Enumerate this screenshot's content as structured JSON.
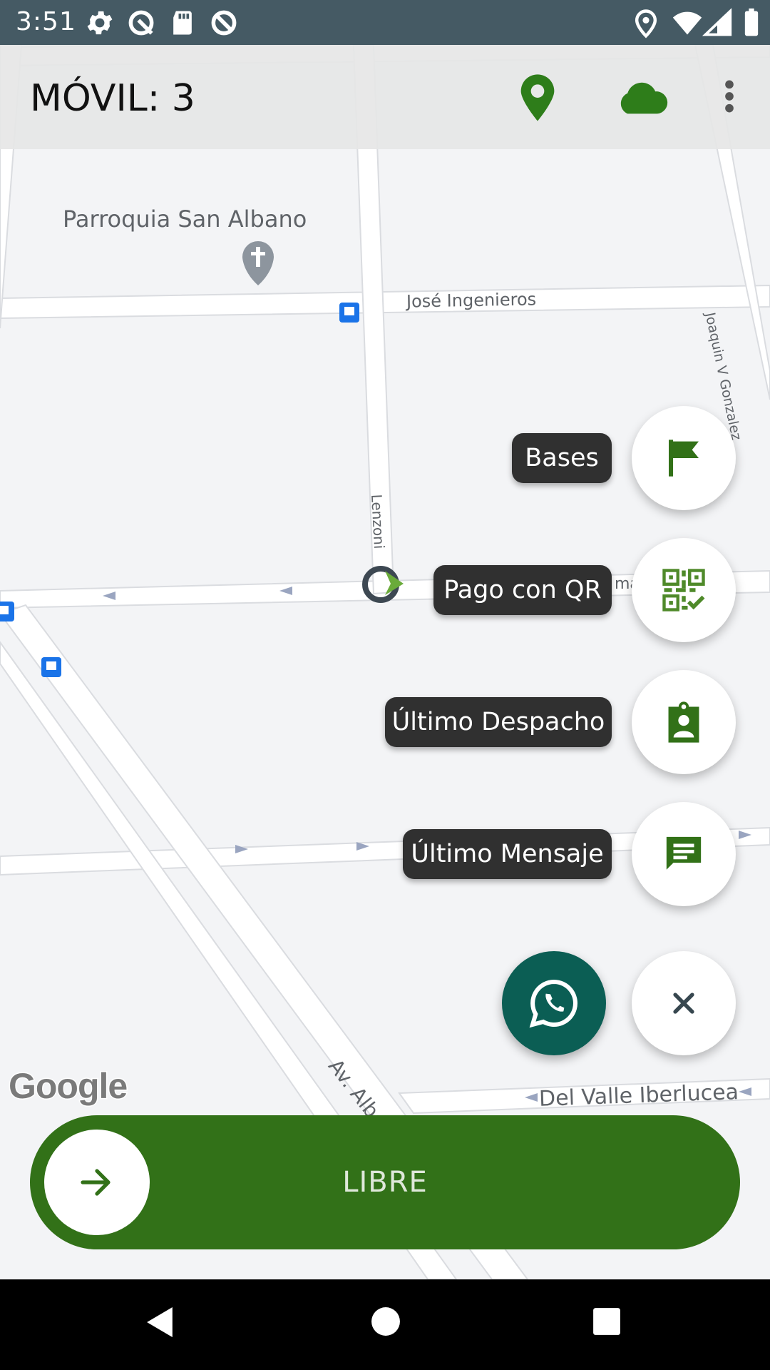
{
  "status_bar": {
    "time": "3:51"
  },
  "header": {
    "title": "MÓVIL: 3"
  },
  "map": {
    "poi_name": "Parroquia San Albano",
    "streets": {
      "jose_ingenieros": "José Ingenieros",
      "joaquin_gonzalez": "Joaquin V Gonzalez",
      "lenzoni": "Lenzoni",
      "partial_street": "ma",
      "av_alberdi": "Av. Alberdi",
      "del_valle": "Del Valle Iberlucea"
    },
    "attribution": "Google"
  },
  "fab_menu": {
    "items": [
      {
        "label": "Bases",
        "icon": "flag-icon"
      },
      {
        "label": "Pago con QR",
        "icon": "qr-code-icon"
      },
      {
        "label": "Último Despacho",
        "icon": "assignment-ind-icon"
      },
      {
        "label": "Último Mensaje",
        "icon": "message-icon"
      }
    ],
    "whatsapp_icon": "whatsapp-icon",
    "close_icon": "close-icon"
  },
  "slider": {
    "label": "LIBRE"
  },
  "colors": {
    "brand_green": "#327118",
    "icon_green": "#2e7d1a",
    "whatsapp": "#0b5e54",
    "status_bar": "#455a64"
  }
}
